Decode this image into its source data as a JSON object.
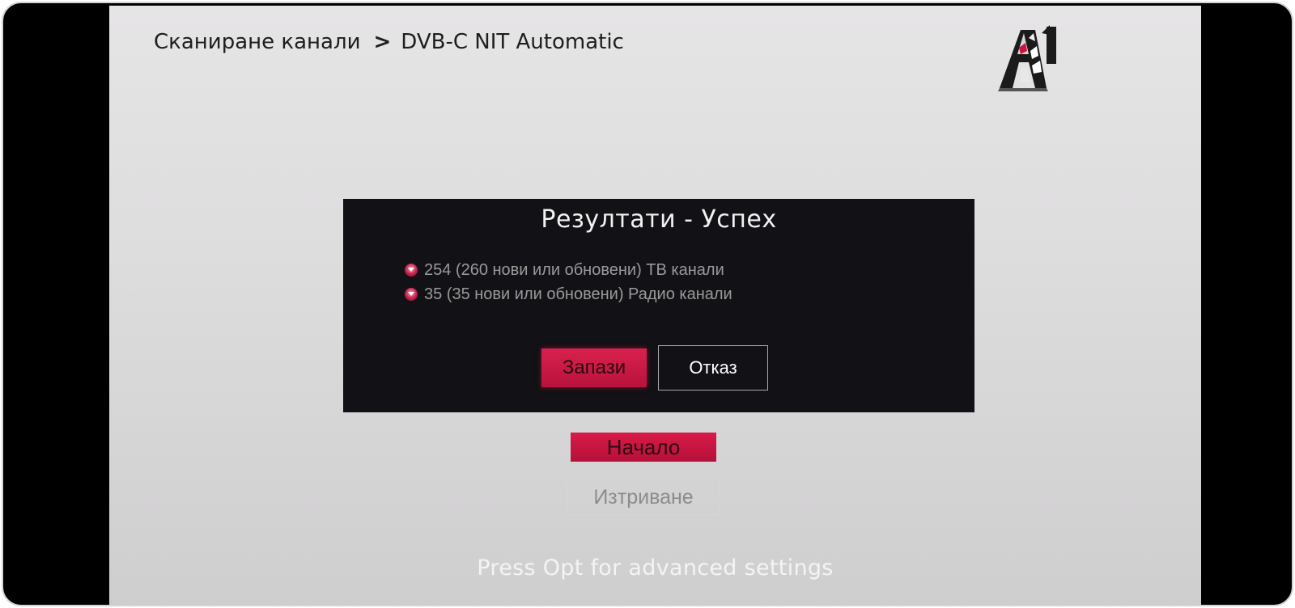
{
  "breadcrumb": {
    "parent": "Сканиране канали",
    "separator": ">",
    "current": "DVB-C NIT Automatic"
  },
  "logo": {
    "name": "A1",
    "text": "A1"
  },
  "dialog": {
    "title": "Резултати - Успех",
    "results": [
      "254 (260 нови или обновени) ТВ канали",
      "35 (35 нови или обновени) Радио канали"
    ],
    "save_label": "Запази",
    "cancel_label": "Отказ"
  },
  "actions": {
    "start_label": "Начало",
    "delete_label": "Изтриване"
  },
  "hint": "Press Opt for advanced settings",
  "colors": {
    "accent": "#c8173f",
    "dialog_bg": "#121115",
    "screen_bg": "#e0dfe0"
  }
}
